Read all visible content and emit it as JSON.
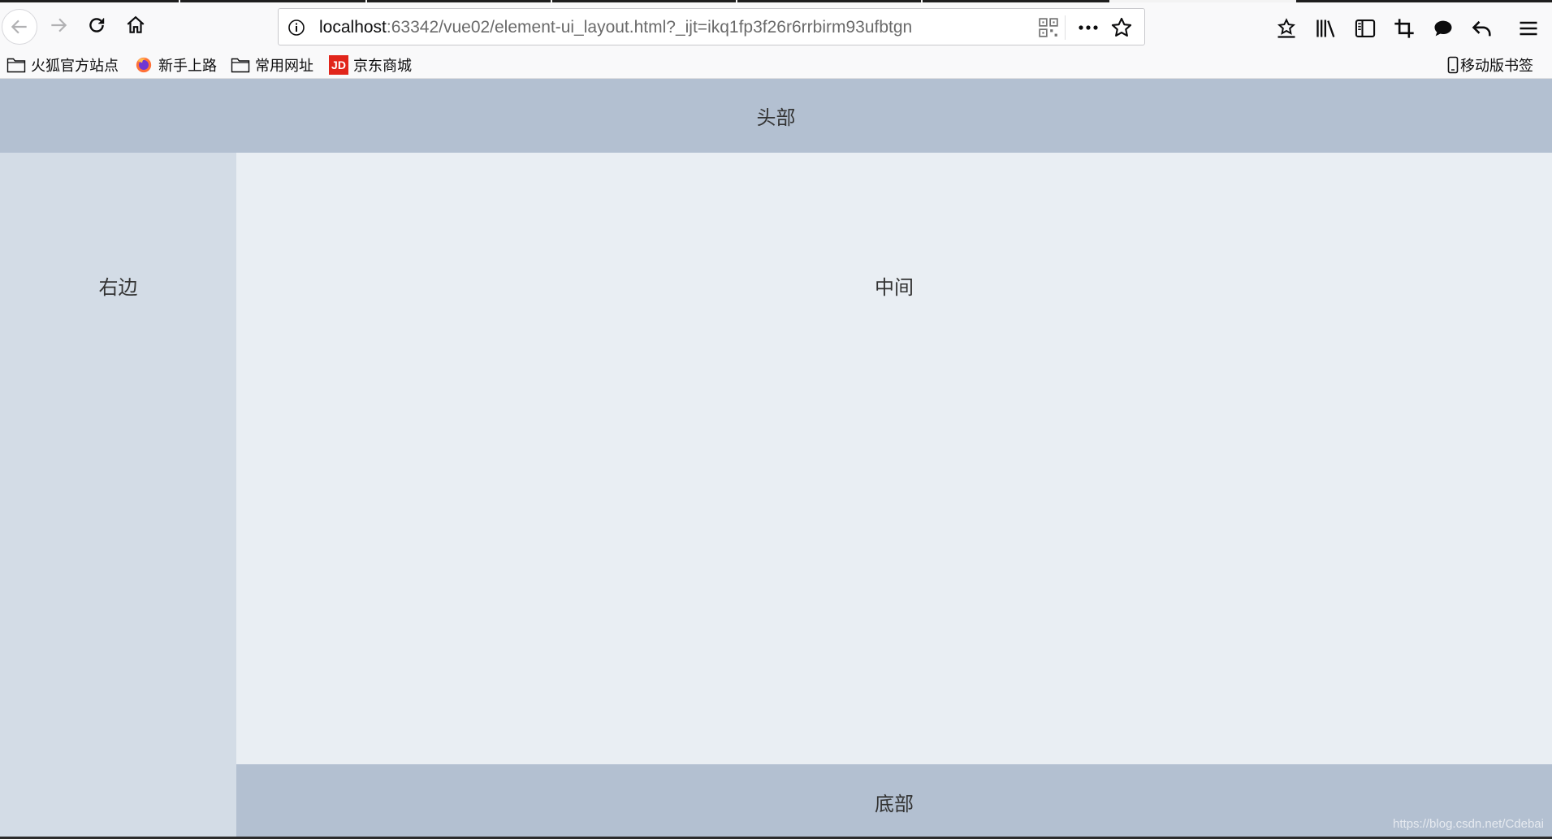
{
  "browser": {
    "url_host": "localhost",
    "url_rest": ":63342/vue02/element-ui_layout.html?_ijt=ikq1fp3f26r6rrbirm93ufbtgn",
    "toolbar_icons": [
      "back-icon",
      "forward-icon",
      "reload-icon",
      "home-icon",
      "info-icon",
      "qr-code-icon",
      "more-icon",
      "star-icon",
      "download-icon",
      "library-icon",
      "sidebar-icon",
      "screenshot-icon",
      "chat-icon",
      "undo-icon",
      "menu-icon"
    ]
  },
  "bookmarks": {
    "items": [
      {
        "label": "火狐官方站点",
        "icon": "folder-icon"
      },
      {
        "label": "新手上路",
        "icon": "firefox-icon"
      },
      {
        "label": "常用网址",
        "icon": "folder-icon"
      },
      {
        "label": "京东商城",
        "icon": "jd-icon",
        "badge": "JD"
      }
    ],
    "mobile": "移动版书签"
  },
  "layout": {
    "header": "头部",
    "aside": "右边",
    "main": "中间",
    "footer": "底部",
    "header_color": "#b3c0d1",
    "aside_color": "#d3dce6",
    "main_color": "#e9eef3"
  },
  "watermark": "https://blog.csdn.net/Cdebai"
}
